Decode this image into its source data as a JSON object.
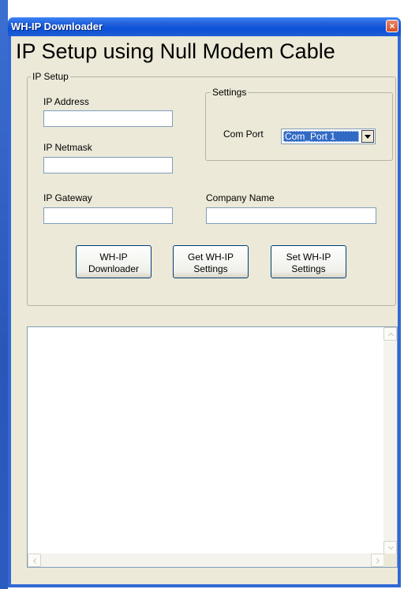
{
  "window": {
    "title": "WH-IP Downloader",
    "close_symbol": "×",
    "heading": "IP Setup using Null Modem Cable"
  },
  "ip_setup": {
    "group_label": "IP Setup",
    "ip_address_label": "IP Address",
    "ip_address_value": "",
    "ip_netmask_label": "IP Netmask",
    "ip_netmask_value": "",
    "ip_gateway_label": "IP Gateway",
    "ip_gateway_value": "",
    "company_name_label": "Company Name",
    "company_name_value": ""
  },
  "settings": {
    "group_label": "Settings",
    "com_port_label": "Com Port",
    "com_port_selected": "Com_Port 1"
  },
  "buttons": {
    "downloader_line1": "WH-IP",
    "downloader_line2": "Downloader",
    "get_line1": "Get WH-IP",
    "get_line2": "Settings",
    "set_line1": "Set WH-IP",
    "set_line2": "Settings"
  },
  "log": {
    "text": ""
  },
  "colors": {
    "titlebar": "#0a50d8",
    "client_bg": "#ece9d8",
    "selection": "#316ac5",
    "close_button": "#d64f24"
  }
}
